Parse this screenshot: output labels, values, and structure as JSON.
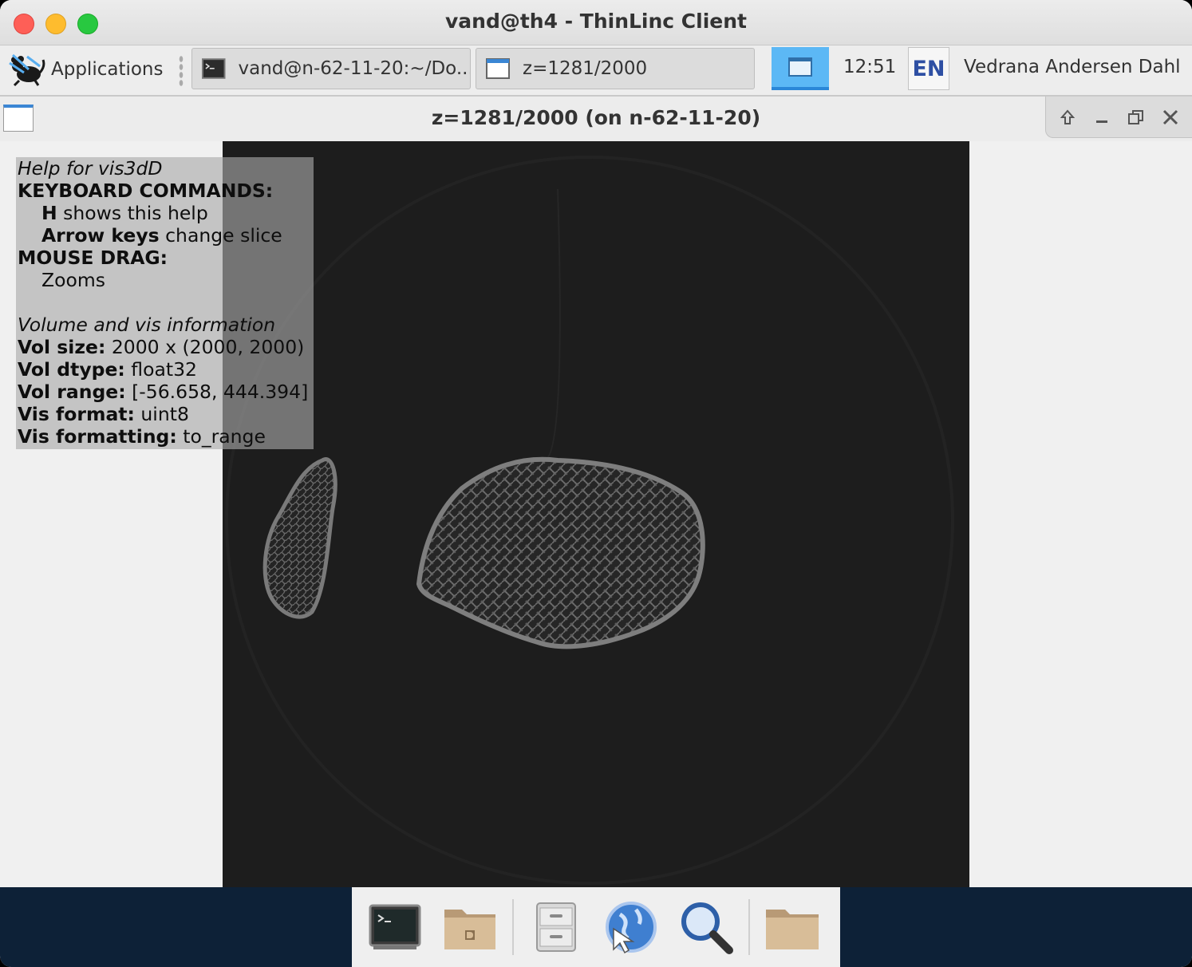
{
  "mac_window": {
    "title": "vand@th4 - ThinLinc Client"
  },
  "panel": {
    "applications_label": "Applications",
    "tasks": [
      {
        "label": "vand@n-62-11-20:~/Do..."
      },
      {
        "label": "z=1281/2000"
      }
    ],
    "clock": "12:51",
    "keyboard_layout": "EN",
    "user_name": "Vedrana Andersen Dahl"
  },
  "app_window": {
    "title": "z=1281/2000 (on n-62-11-20)"
  },
  "help_overlay": {
    "heading": "Help for vis3dD",
    "keyboard_heading": "KEYBOARD COMMANDS:",
    "key_h": "H",
    "key_h_desc": " shows this help",
    "key_arrows": "Arrow keys",
    "key_arrows_desc": " change slice",
    "mouse_heading": "MOUSE DRAG:",
    "mouse_desc": "Zooms",
    "info_heading": "Volume and vis information",
    "vol_size_label": "Vol size:",
    "vol_size_value": " 2000 x (2000, 2000)",
    "vol_dtype_label": "Vol dtype:",
    "vol_dtype_value": " float32",
    "vol_range_label": "Vol range:",
    "vol_range_value": " [-56.658, 444.394]",
    "vis_format_label": "Vis format:",
    "vis_format_value": " uint8",
    "vis_formatting_label": "Vis formatting:",
    "vis_formatting_value": " to_range"
  },
  "dock": {
    "items": [
      "terminal-icon",
      "home-folder-icon",
      "file-manager-icon",
      "web-browser-icon",
      "search-icon",
      "folder-icon"
    ]
  },
  "colors": {
    "accent": "#5cb8f5",
    "slice_background": "#1d1d1d",
    "dock_background": "#0d2137"
  }
}
